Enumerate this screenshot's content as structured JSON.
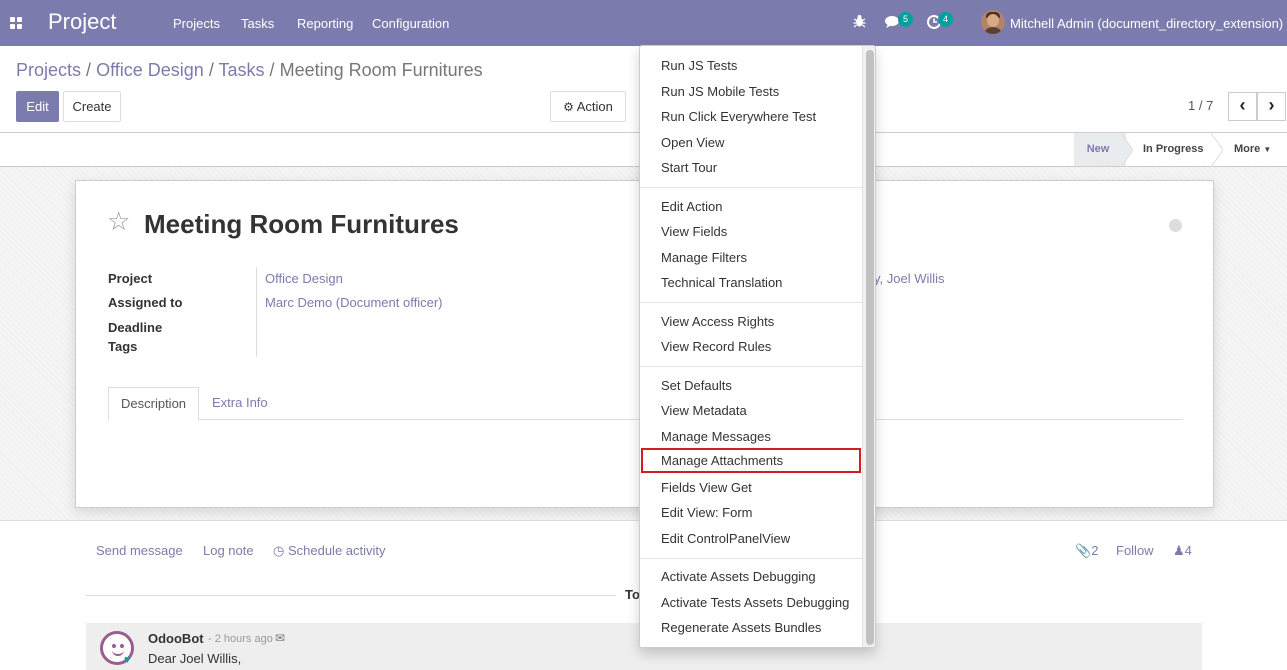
{
  "navbar": {
    "brand": "Project",
    "menus": [
      "Projects",
      "Tasks",
      "Reporting",
      "Configuration"
    ],
    "messages_count": "5",
    "activities_count": "4",
    "user": "Mitchell Admin (document_directory_extension)"
  },
  "breadcrumb": {
    "items": [
      "Projects",
      "Office Design",
      "Tasks"
    ],
    "current": "Meeting Room Furnitures",
    "separator": "/"
  },
  "buttons": {
    "edit": "Edit",
    "create": "Create",
    "action": "Action"
  },
  "pager": {
    "value": "1 / 7"
  },
  "stages": {
    "new": "New",
    "in_progress": "In Progress",
    "more": "More"
  },
  "record": {
    "title": "Meeting Room Furnitures",
    "fields": [
      {
        "label": "Project",
        "value": "Office Design"
      },
      {
        "label": "Assigned to",
        "value": "Marc Demo (Document officer)"
      },
      {
        "label": "Deadline",
        "value": ""
      },
      {
        "label": "Tags",
        "value": ""
      }
    ],
    "followers_text": "y, Joel Willis"
  },
  "tabs": [
    "Description",
    "Extra Info"
  ],
  "chatter": {
    "send_message": "Send message",
    "log_note": "Log note",
    "schedule_activity": "Schedule activity",
    "attachments_count": "2",
    "follow": "Follow",
    "followers_count": "4",
    "today": "To",
    "message": {
      "author": "OdooBot",
      "time": "- 2 hours ago",
      "body": "Dear Joel Willis,"
    }
  },
  "debug_menu": {
    "groups": [
      [
        "Run JS Tests",
        "Run JS Mobile Tests",
        "Run Click Everywhere Test",
        "Open View",
        "Start Tour"
      ],
      [
        "Edit Action",
        "View Fields",
        "Manage Filters",
        "Technical Translation"
      ],
      [
        "View Access Rights",
        "View Record Rules"
      ],
      [
        "Set Defaults",
        "View Metadata",
        "Manage Messages",
        "Manage Attachments",
        "Fields View Get",
        "Edit View: Form",
        "Edit ControlPanelView"
      ],
      [
        "Activate Assets Debugging",
        "Activate Tests Assets Debugging",
        "Regenerate Assets Bundles"
      ]
    ],
    "highlighted": "Manage Attachments"
  },
  "colors": {
    "brand": "#7c7bad",
    "highlight_border": "#d01e23",
    "badge_messages": "#00a09d",
    "badge_activities": "#00a09d"
  }
}
